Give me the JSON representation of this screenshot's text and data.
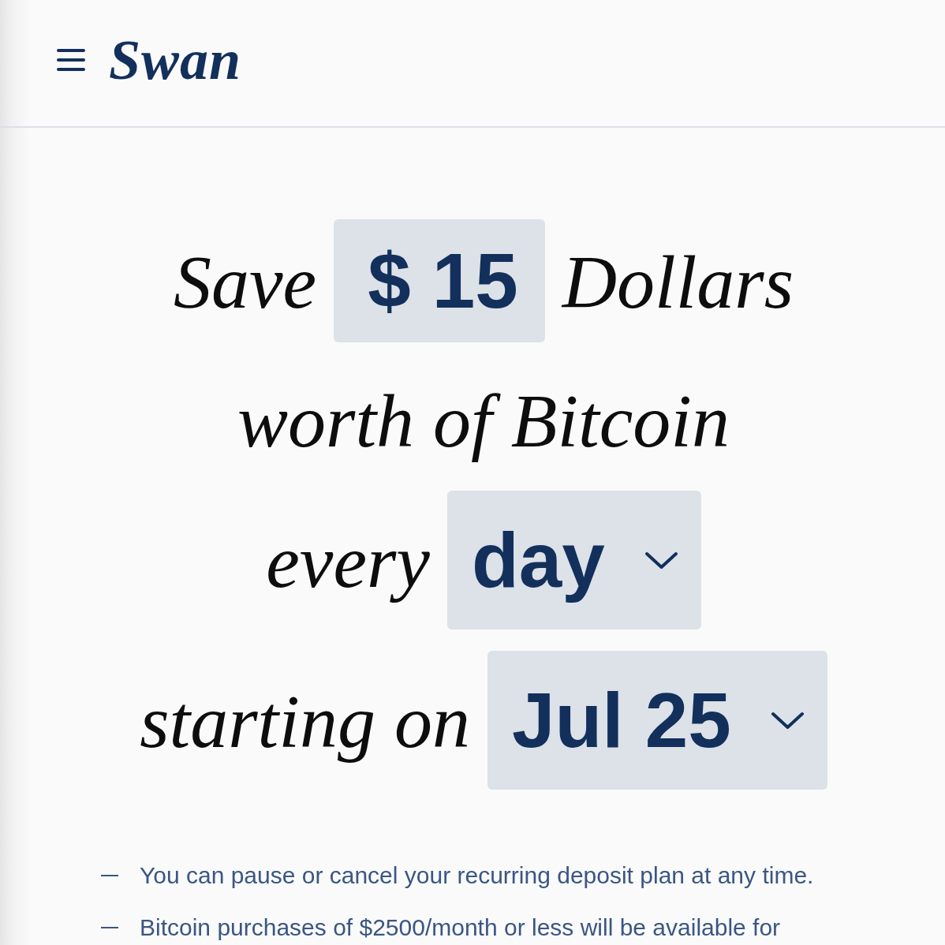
{
  "header": {
    "logo": "Swan"
  },
  "plan": {
    "rows": [
      {
        "parts": [
          {
            "kind": "text",
            "text": "Save"
          },
          {
            "kind": "amount",
            "prefix": "$",
            "value": "15"
          },
          {
            "kind": "text",
            "text": "Dollars"
          }
        ]
      },
      {
        "parts": [
          {
            "kind": "text",
            "text": "worth of Bitcoin"
          }
        ]
      },
      {
        "parts": [
          {
            "kind": "text",
            "text": "every"
          },
          {
            "kind": "select",
            "value": "day"
          }
        ]
      },
      {
        "parts": [
          {
            "kind": "text",
            "text": "starting on"
          },
          {
            "kind": "select",
            "value": "Jul 25"
          }
        ]
      }
    ]
  },
  "notes": [
    "You can pause or cancel your recurring deposit plan at any time.",
    "Bitcoin purchases of $2500/month or less will be available for"
  ]
}
